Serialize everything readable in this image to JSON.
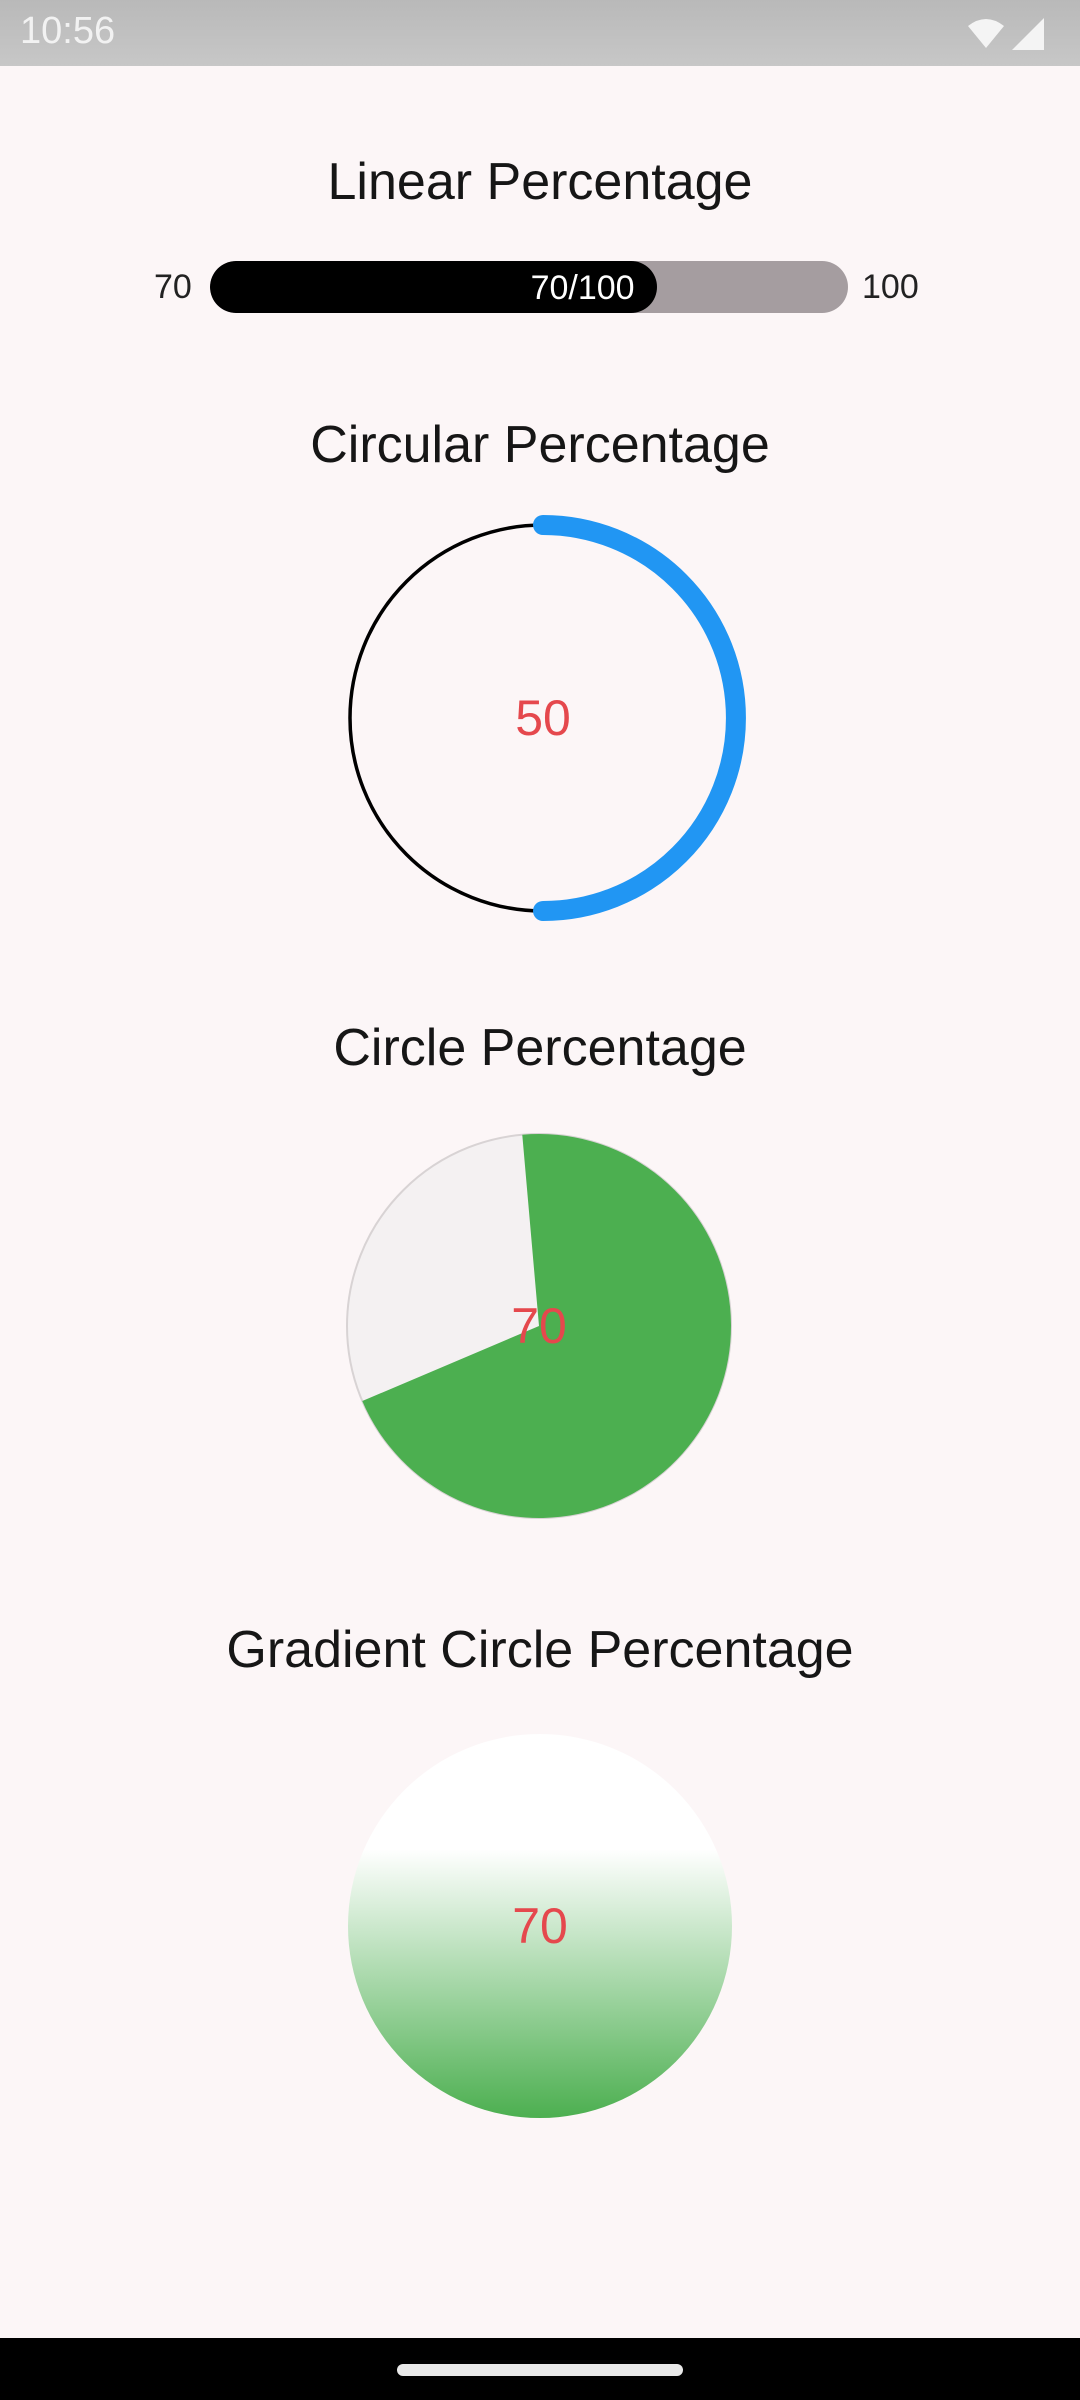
{
  "status_bar": {
    "time": "10:56",
    "icons": [
      "wifi-icon",
      "signal-icon"
    ]
  },
  "linear": {
    "title": "Linear Percentage",
    "left_label": "70",
    "right_label": "100",
    "bar_text": "70/100",
    "value": 70,
    "max": 100,
    "fill_color": "#000000",
    "track_color": "#a59da0"
  },
  "circular": {
    "title": "Circular Percentage",
    "value_text": "50",
    "percent": 50,
    "progress_color": "#2196f3",
    "track_color": "#000000",
    "text_color": "#e5484d"
  },
  "circle": {
    "title": "Circle Percentage",
    "value_text": "70",
    "percent": 70,
    "fill_color": "#4caf50",
    "bg_color": "#f4f1f2"
  },
  "gradient_circle": {
    "title": "Gradient Circle Percentage",
    "value_text": "70",
    "percent": 70,
    "gradient_from": "#ffffff",
    "gradient_to": "#4caf50"
  }
}
